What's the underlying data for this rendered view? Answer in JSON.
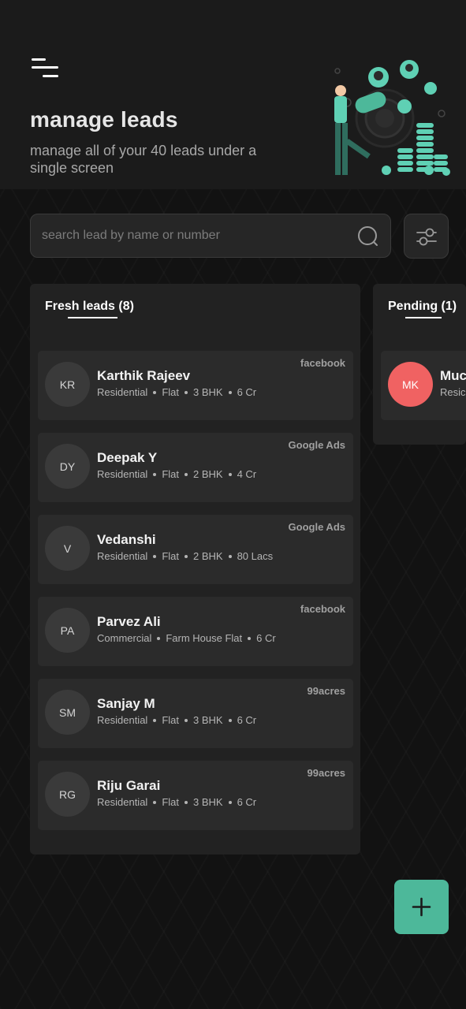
{
  "header": {
    "title": "manage leads",
    "subtitle": "manage all of your 40 leads under a single screen"
  },
  "search": {
    "placeholder": "search lead by name or number"
  },
  "columns": {
    "fresh": {
      "label_prefix": "Fresh ",
      "label_underlined": "leads",
      "count": " (8)",
      "cards": [
        {
          "initials": "KR",
          "name": "Karthik Rajeev",
          "meta": [
            "Residential",
            "Flat",
            "3 BHK",
            "6 Cr"
          ],
          "source": "facebook"
        },
        {
          "initials": "DY",
          "name": "Deepak Y",
          "meta": [
            "Residential",
            "Flat",
            "2 BHK",
            "4 Cr"
          ],
          "source": "Google Ads"
        },
        {
          "initials": "V",
          "name": "Vedanshi",
          "meta": [
            "Residential",
            "Flat",
            "2 BHK",
            "80 Lacs"
          ],
          "source": "Google Ads"
        },
        {
          "initials": "PA",
          "name": "Parvez Ali",
          "meta": [
            "Commercial",
            "Farm House Flat",
            "6 Cr"
          ],
          "source": "facebook"
        },
        {
          "initials": "SM",
          "name": "Sanjay M",
          "meta": [
            "Residential",
            "Flat",
            "3 BHK",
            "6 Cr"
          ],
          "source": "99acres"
        },
        {
          "initials": "RG",
          "name": "Riju Garai",
          "meta": [
            "Residential",
            "Flat",
            "3 BHK",
            "6 Cr"
          ],
          "source": "99acres"
        }
      ]
    },
    "pending": {
      "label_prefix": "",
      "label_underlined": "Pending",
      "count": " (1)",
      "cards": [
        {
          "initials": "MK",
          "name": "Muc",
          "meta": [
            "Resic"
          ]
        }
      ]
    }
  },
  "colors": {
    "accent": "#4db89a",
    "pending_avatar": "#f06262",
    "background": "#121212",
    "card": "#2b2b2b"
  },
  "icons": {
    "menu": "menu-icon",
    "search": "search-icon",
    "filter": "filter-sliders-icon",
    "add": "plus-icon"
  }
}
